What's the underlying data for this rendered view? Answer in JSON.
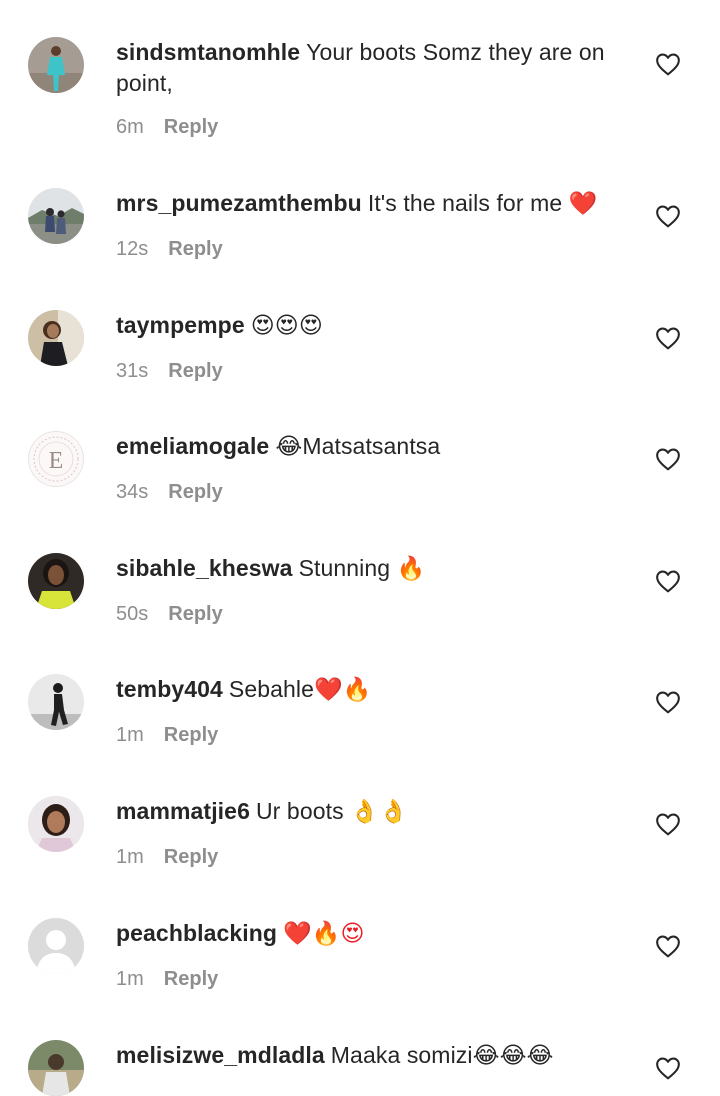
{
  "comments": [
    {
      "username": "sindsmtanomhle",
      "text": "Your boots Somz they are on point,",
      "emoji": "",
      "time": "6m",
      "reply_label": "Reply",
      "avatar": "photo-woman-blue-outfit"
    },
    {
      "username": "mrs_pumezamthembu",
      "text": "It's the nails for me",
      "emoji": "❤️",
      "time": "12s",
      "reply_label": "Reply",
      "avatar": "photo-couple-outdoors"
    },
    {
      "username": "taympempe",
      "text": "",
      "emoji": "😍😍😍",
      "time": "31s",
      "reply_label": "Reply",
      "avatar": "photo-woman-selfie"
    },
    {
      "username": "emeliamogale",
      "text": "Matsatsantsa",
      "emoji": "😂",
      "time": "34s",
      "reply_label": "Reply",
      "avatar": "logo-letter-e",
      "avatar_letter": "E"
    },
    {
      "username": "sibahle_kheswa",
      "text": "Stunning",
      "emoji": "🔥",
      "time": "50s",
      "reply_label": "Reply",
      "avatar": "photo-woman-yellow-top"
    },
    {
      "username": "temby404",
      "text": "Sebahle",
      "emoji": "❤️🔥",
      "time": "1m",
      "reply_label": "Reply",
      "avatar": "photo-figure-black-white"
    },
    {
      "username": "mammatjie6",
      "text": "Ur boots",
      "emoji": "👌👌",
      "time": "1m",
      "reply_label": "Reply",
      "avatar": "photo-woman-portrait"
    },
    {
      "username": "peachblacking",
      "text": "",
      "emoji": "❤️🔥😍",
      "time": "1m",
      "reply_label": "Reply",
      "avatar": "default-profile"
    },
    {
      "username": "melisizwe_mdladla",
      "text": "Maaka somizi",
      "emoji": "😂😂😂",
      "time": "",
      "reply_label": "",
      "avatar": "photo-man-outdoors"
    }
  ],
  "icons": {
    "like": "heart-outline-icon"
  },
  "colors": {
    "text": "#262626",
    "meta": "#8e8e8e",
    "heart_stroke": "#262626",
    "heart_red": "#ed1c24"
  }
}
